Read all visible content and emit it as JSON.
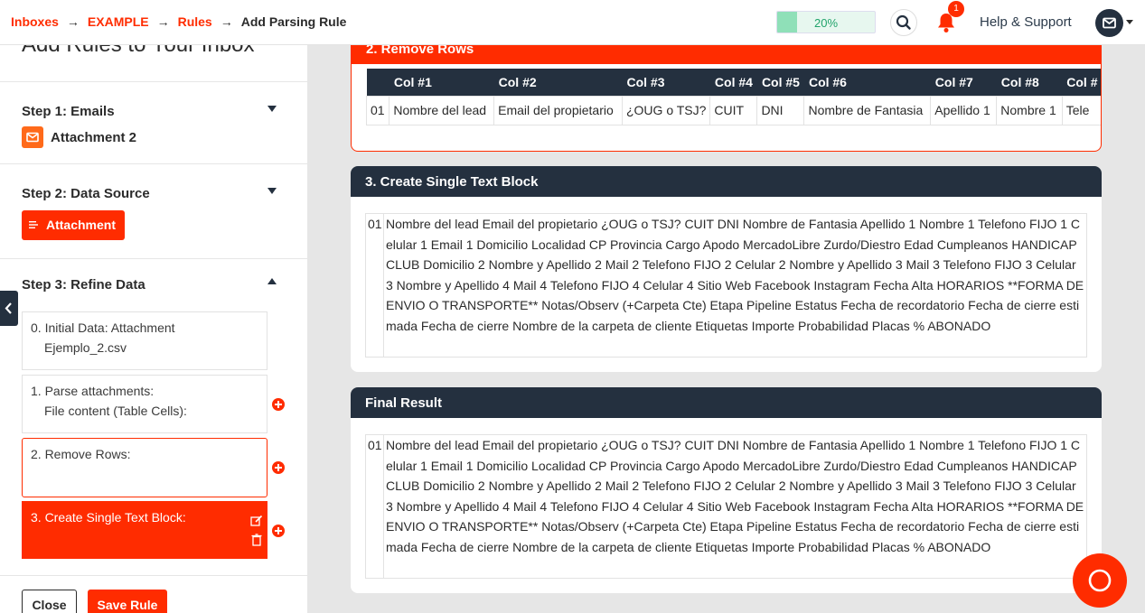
{
  "breadcrumb": {
    "inboxes": "Inboxes",
    "example": "EXAMPLE",
    "rules": "Rules",
    "current": "Add Parsing Rule"
  },
  "progress": {
    "label": "20%",
    "value": 0.2
  },
  "notifications": {
    "count": "1"
  },
  "help": "Help & Support",
  "sidebar": {
    "title": "Add Rules to Your Inbox",
    "step1": {
      "title": "Step 1: Emails",
      "attachment": "Attachment 2"
    },
    "step2": {
      "title": "Step 2: Data Source",
      "button": "Attachment"
    },
    "step3": {
      "title": "Step 3: Refine Data",
      "rules": [
        {
          "line1": "0. Initial Data: Attachment",
          "line2": "Ejemplo_2.csv"
        },
        {
          "line1": "1. Parse attachments:",
          "line2": "File content (Table Cells):"
        },
        {
          "line1": "2. Remove Rows:"
        },
        {
          "line1": "3. Create Single Text Block:"
        }
      ]
    },
    "close": "Close",
    "save": "Save Rule"
  },
  "remove_rows": {
    "title": "2. Remove Rows",
    "columns": [
      "Col #1",
      "Col #2",
      "Col #3",
      "Col #4",
      "Col #5",
      "Col #6",
      "Col #7",
      "Col #8",
      "Col #"
    ],
    "row": [
      "01",
      "Nombre del lead",
      "Email del propietario",
      "¿OUG o TSJ?",
      "CUIT",
      "DNI",
      "Nombre de Fantasia",
      "Apellido 1",
      "Nombre 1",
      "Tele"
    ]
  },
  "single_text": {
    "title": "3. Create Single Text Block",
    "num": "01",
    "text": "Nombre del lead Email del propietario ¿OUG o TSJ? CUIT DNI Nombre de Fantasia Apellido 1 Nombre 1 Telefono FIJO 1 Celular 1 Email 1 Domicilio Localidad CP Provincia Cargo Apodo MercadoLibre Zurdo/Diestro Edad Cumpleanos HANDICAP CLUB Domicilio 2 Nombre y Apellido 2 Mail 2 Telefono FIJO 2 Celular 2 Nombre y Apellido 3 Mail 3 Telefono FIJO 3 Celular 3 Nombre y Apellido 4 Mail 4 Telefono FIJO 4 Celular 4 Sitio Web Facebook Instagram Fecha Alta HORARIOS **FORMA DE ENVIO O TRANSPORTE** Notas/Observ (+Carpeta Cte) Etapa Pipeline Estatus Fecha de recordatorio Fecha de cierre estimada Fecha de cierre Nombre de la carpeta de cliente Etiquetas Importe Probabilidad Placas %  ABONADO"
  },
  "final_result": {
    "title": "Final Result",
    "num": "01",
    "text": "Nombre del lead Email del propietario ¿OUG o TSJ? CUIT DNI Nombre de Fantasia Apellido 1 Nombre 1 Telefono FIJO 1 Celular 1 Email 1 Domicilio Localidad CP Provincia Cargo Apodo MercadoLibre Zurdo/Diestro Edad Cumpleanos HANDICAP CLUB Domicilio 2 Nombre y Apellido 2 Mail 2 Telefono FIJO 2 Celular 2 Nombre y Apellido 3 Mail 3 Telefono FIJO 3 Celular 3 Nombre y Apellido 4 Mail 4 Telefono FIJO 4 Celular 4 Sitio Web Facebook Instagram Fecha Alta HORARIOS **FORMA DE ENVIO O TRANSPORTE** Notas/Observ (+Carpeta Cte) Etapa Pipeline Estatus Fecha de recordatorio Fecha de cierre estimada Fecha de cierre Nombre de la carpeta de cliente Etiquetas Importe Probabilidad Placas %  ABONADO"
  },
  "colors": {
    "accent": "#ff2c00",
    "dark": "#24303f",
    "progress": "#8fe0b8"
  }
}
